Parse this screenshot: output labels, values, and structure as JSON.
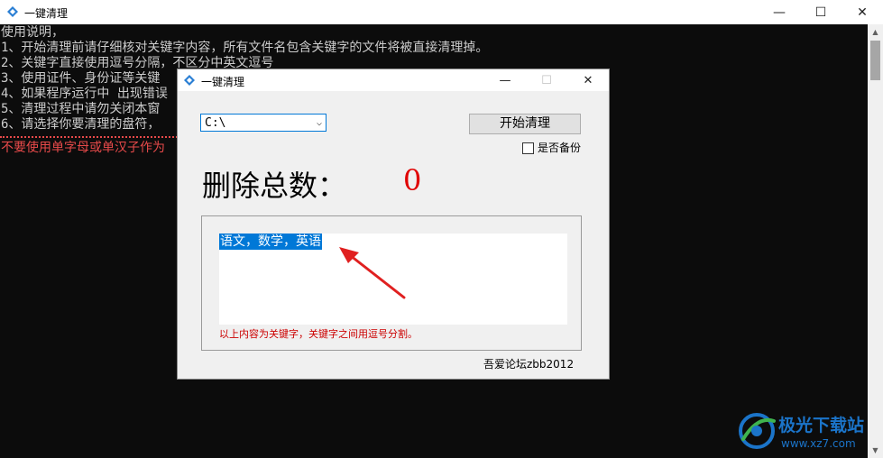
{
  "outer_window": {
    "title": "一键清理",
    "icon": "app-logo-icon",
    "minimize": "—",
    "maximize": "☐",
    "close": "✕"
  },
  "console": {
    "lines": [
      "使用说明，",
      "1、开始清理前请仔细核对关键字内容，所有文件名包含关键字的文件将被直接清理掉。",
      "2、关键字直接使用逗号分隔，不区分中英文逗号",
      "3、使用证件、身份证等关键",
      "4、如果程序运行中 出现错误",
      "5、清理过程中请勿关闭本窗",
      "6、请选择你要清理的盘符，"
    ],
    "warning": "不要使用单字母或单汉子作为"
  },
  "dialog": {
    "title": "一键清理",
    "minimize": "—",
    "maximize": "☐",
    "close": "✕",
    "drive": "C:\\",
    "start_button": "开始清理",
    "backup_label": "是否备份",
    "total_label": "删除总数：",
    "total_value": "0",
    "keywords": "语文，数学，英语",
    "hint": "以上内容为关键字，关键字之间用逗号分割。",
    "credit": "吾爱论坛zbb2012"
  },
  "watermark": {
    "name": "极光下载站",
    "url": "www.xz7.com"
  },
  "colors": {
    "console_bg": "#0c0c0c",
    "console_text": "#cccccc",
    "warning_red": "#e84a4a",
    "accent_blue": "#0078d7",
    "total_red": "#e00000",
    "arrow_red": "#e02020"
  }
}
